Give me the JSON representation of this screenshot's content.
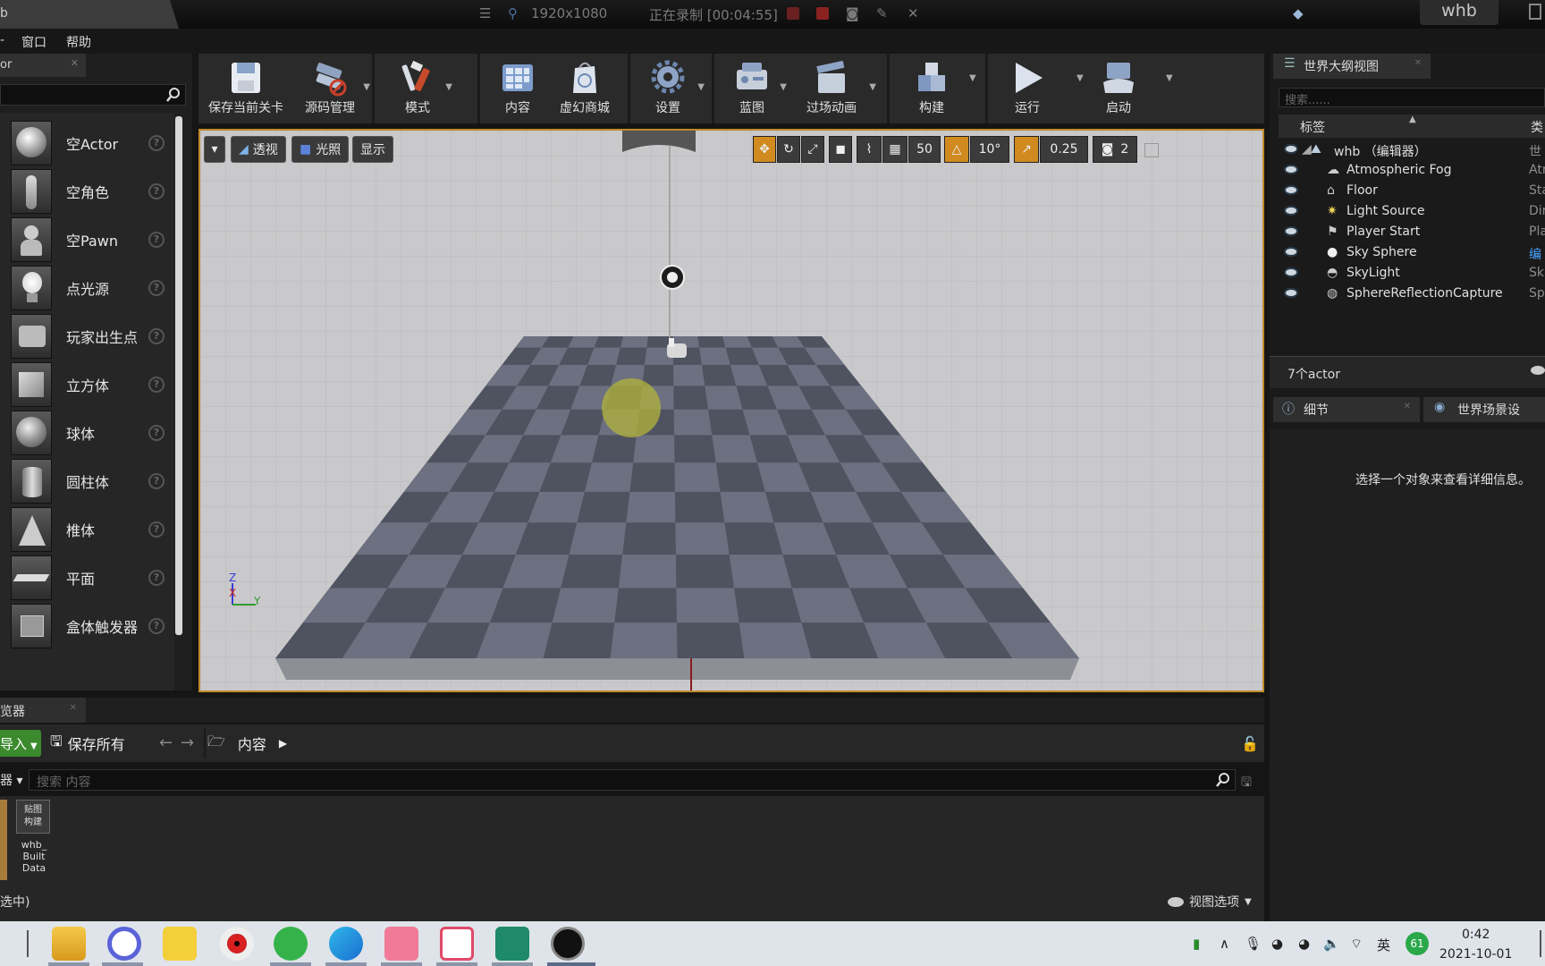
{
  "titlebar": {
    "tab_title": "b",
    "resolution": "1920x1080",
    "recording": "正在录制 [00:04:55]",
    "user": "whb"
  },
  "menu": {
    "items": [
      "窗口",
      "帮助"
    ]
  },
  "left_panel": {
    "tab": "or",
    "items": [
      {
        "label": "空Actor"
      },
      {
        "label": "空角色"
      },
      {
        "label": "空Pawn"
      },
      {
        "label": "点光源"
      },
      {
        "label": "玩家出生点"
      },
      {
        "label": "立方体"
      },
      {
        "label": "球体"
      },
      {
        "label": "圆柱体"
      },
      {
        "label": "椎体"
      },
      {
        "label": "平面"
      },
      {
        "label": "盒体触发器"
      }
    ]
  },
  "toolbar": {
    "buttons": [
      "保存当前关卡",
      "源码管理",
      "模式",
      "内容",
      "虚幻商城",
      "设置",
      "蓝图",
      "过场动画",
      "构建",
      "运行",
      "启动"
    ]
  },
  "viewport": {
    "perspective": "透视",
    "lighting": "光照",
    "show": "显示",
    "grid_snap": "50",
    "rotation_snap": "10°",
    "scale_snap": "0.25",
    "camera_speed": "2",
    "axis_z": "Z",
    "axis_x": "X",
    "axis_y": "Y"
  },
  "outliner": {
    "tab": "世界大纲视图",
    "search_placeholder": "搜索......",
    "col_label": "标签",
    "col_type": "类",
    "rows": [
      {
        "label": "whb （编辑器）",
        "type": "世"
      },
      {
        "label": "Atmospheric Fog",
        "type": "Atr"
      },
      {
        "label": "Floor",
        "type": "Sta"
      },
      {
        "label": "Light Source",
        "type": "Dir"
      },
      {
        "label": "Player Start",
        "type": "Pla"
      },
      {
        "label": "Sky Sphere",
        "type": "编"
      },
      {
        "label": "SkyLight",
        "type": "Sk"
      },
      {
        "label": "SphereReflectionCapture",
        "type": "Sp"
      }
    ],
    "count": "7个actor"
  },
  "details": {
    "tab": "细节",
    "tab2": "世界场景设",
    "empty_msg": "选择一个对象来查看详细信息。"
  },
  "content_browser": {
    "tab": "览器",
    "import": "导入",
    "save_all": "保存所有",
    "path": "内容",
    "filter": "器",
    "search_placeholder": "搜索 内容",
    "asset_thumb_line1": "贴图",
    "asset_thumb_line2": "构建",
    "asset_name": "whb_ Built Data",
    "status": "选中)",
    "view_options": "视图选项"
  },
  "taskbar": {
    "time": "0:42",
    "date": "2021-10-01",
    "ime": "英",
    "badge": "61"
  },
  "colors": {
    "accent_orange": "#d08a20",
    "import_green": "#3c8a2e",
    "viewport_bg": "#c9c9cb",
    "checker_dark": "#4f5360",
    "checker_light": "#6c7080"
  }
}
